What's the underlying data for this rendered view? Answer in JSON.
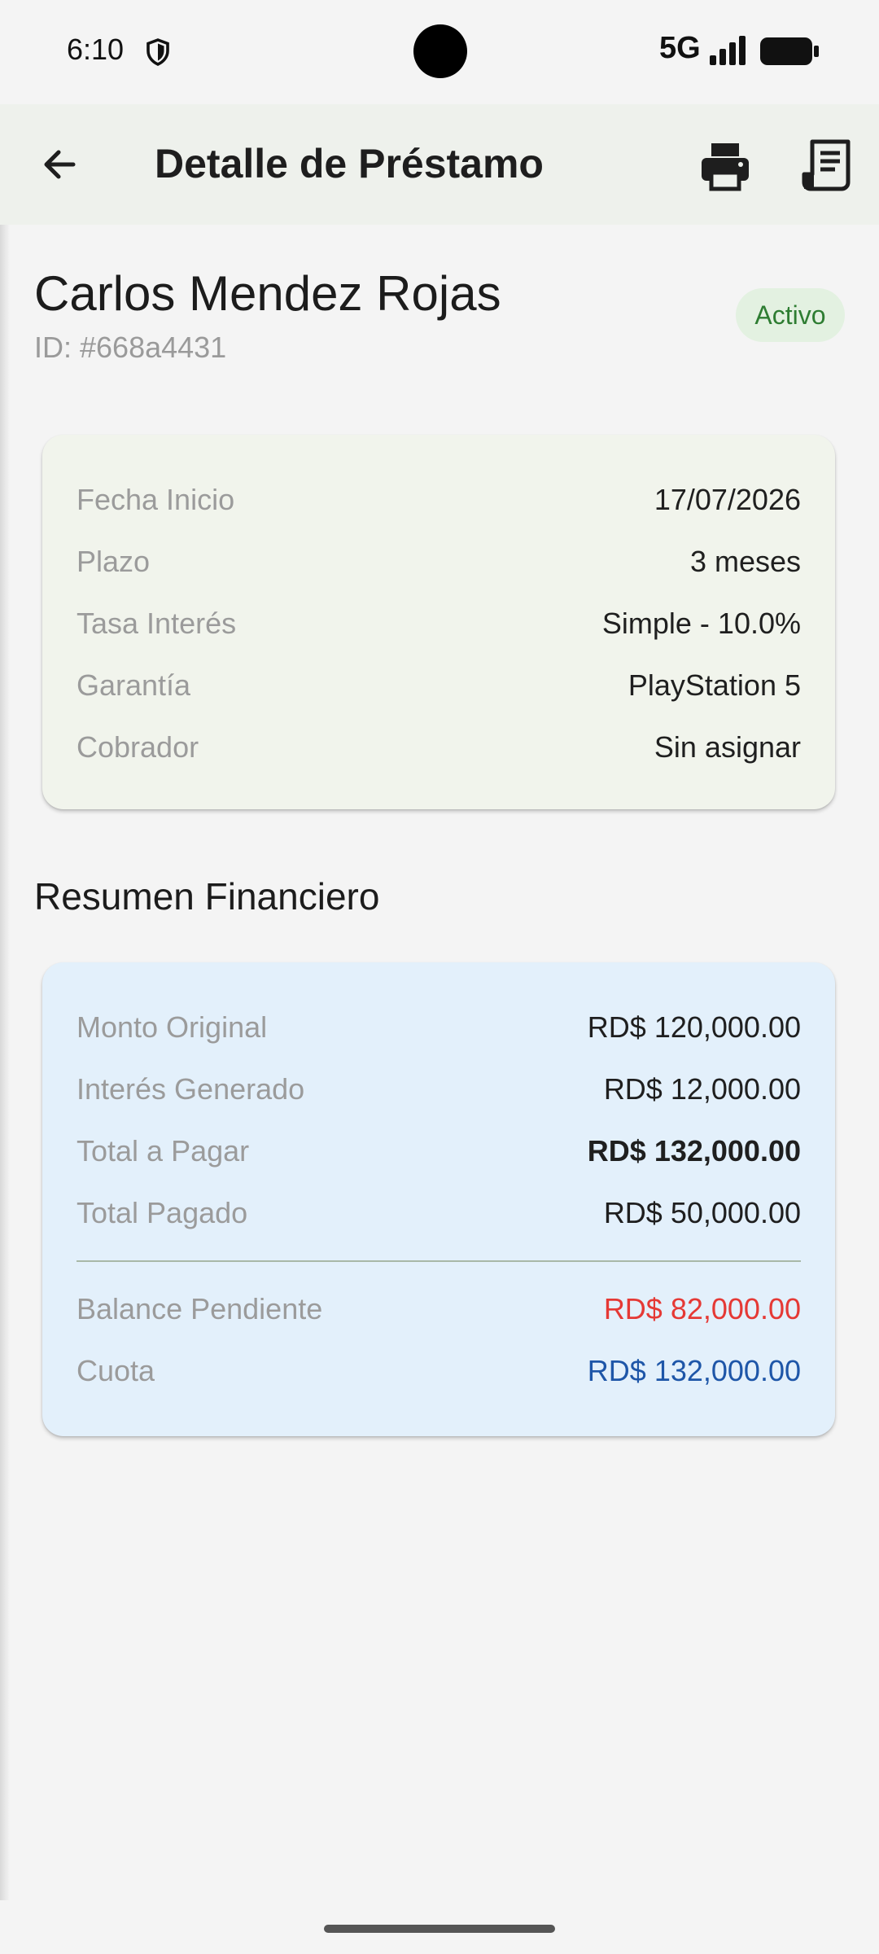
{
  "status_bar": {
    "time": "6:10",
    "network": "5G"
  },
  "app_bar": {
    "title": "Detalle de Préstamo"
  },
  "client": {
    "name": "Carlos Mendez Rojas",
    "id": "ID: #668a4431",
    "status": "Activo"
  },
  "loan_info": [
    {
      "label": "Fecha Inicio",
      "value": "17/07/2026"
    },
    {
      "label": "Plazo",
      "value": "3 meses"
    },
    {
      "label": "Tasa Interés",
      "value": "Simple - 10.0%"
    },
    {
      "label": "Garantía",
      "value": "PlayStation 5"
    },
    {
      "label": "Cobrador",
      "value": "Sin asignar"
    }
  ],
  "financial_summary": {
    "title": "Resumen Financiero",
    "rows": [
      {
        "label": "Monto Original",
        "value": "RD$ 120,000.00"
      },
      {
        "label": "Interés Generado",
        "value": "RD$ 12,000.00"
      },
      {
        "label": "Total a Pagar",
        "value": "RD$ 132,000.00"
      },
      {
        "label": "Total Pagado",
        "value": "RD$ 50,000.00"
      },
      {
        "label": "Balance Pendiente",
        "value": "RD$ 82,000.00"
      },
      {
        "label": "Cuota",
        "value": "RD$ 132,000.00"
      }
    ]
  },
  "colors": {
    "status_green": "#2e7d32",
    "balance_red": "#e53935",
    "cuota_blue": "#1e56a8",
    "info_card_bg": "#f1f4ec",
    "financial_card_bg": "#e3f0fb"
  },
  "icons": [
    "shield-icon",
    "signal-icon",
    "battery-icon",
    "back-arrow-icon",
    "print-icon",
    "receipt-icon"
  ]
}
